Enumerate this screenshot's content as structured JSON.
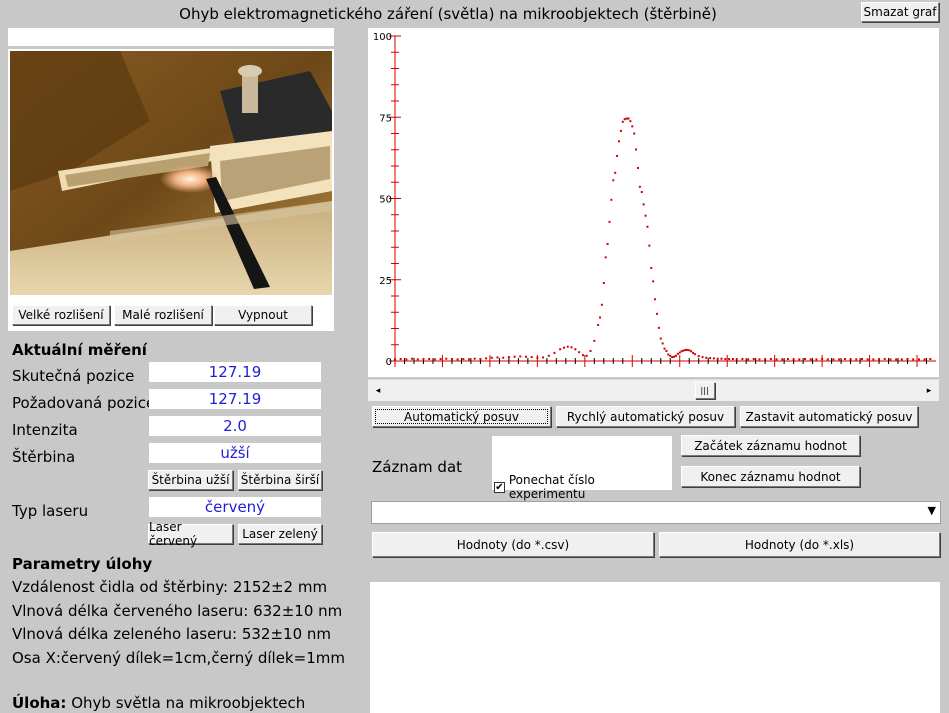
{
  "window": {
    "title": "Ohyb elektromagnetického záření (světla) na mikroobjektech (štěrbině)",
    "clear_graph_label": "Smazat graf"
  },
  "camera": {
    "buttons": [
      "Velké rozlišení",
      "Malé rozlišení",
      "Vypnout"
    ]
  },
  "measurement": {
    "heading": "Aktuální měření",
    "actual_position_label": "Skutečná pozice",
    "actual_position_value": "127.19",
    "requested_position_label": "Požadovaná pozice",
    "requested_position_value": "127.19",
    "intensity_label": "Intenzita",
    "intensity_value": "2.0",
    "slit_label": "Štěrbina",
    "slit_value": "užší",
    "slit_narrow_button": "Štěrbina užší",
    "slit_wide_button": "Štěrbina širší",
    "laser_label": "Typ laseru",
    "laser_value": "červený",
    "laser_red_button": "Laser červený",
    "laser_green_button": "Laser zelený"
  },
  "parameters": {
    "heading": "Parametry úlohy",
    "lines": [
      "Vzdálenost čidla od štěrbiny: 2152±2 mm",
      "Vlnová délka červeného laseru: 632±10 nm",
      "Vlnová délka zeleného laseru: 532±10 nm",
      "Osa X:červený dílek=1cm,černý dílek=1mm"
    ],
    "task_label": "Úloha:",
    "task_value": "Ohyb světla na mikroobjektech"
  },
  "controls": {
    "auto_move": "Automatický posuv",
    "fast_auto_move": "Rychlý automatický posuv",
    "stop_auto_move": "Zastavit automatický posuv",
    "record_label": "Záznam dat",
    "keep_number_label": "Ponechat číslo experimentu",
    "keep_number_checked": true,
    "start_record": "Začátek záznamu hodnot",
    "end_record": "Konec záznamu hodnot",
    "dropdown_value": "",
    "export_csv": "Hodnoty (do *.csv)",
    "export_xls": "Hodnoty (do *.xls)"
  },
  "scrollbar": {
    "left_arrow": "◂",
    "right_arrow": "▸",
    "thumb_grip": "|||",
    "thumb_fraction": 0.6
  },
  "chart_data": {
    "type": "scatter",
    "color": "#d00000",
    "yticks": [
      "100",
      "75",
      "50",
      "25",
      "0"
    ],
    "ylim": [
      0,
      100
    ],
    "xlim": [
      0,
      570
    ],
    "x": [
      0,
      6,
      12,
      18,
      24,
      30,
      36,
      42,
      48,
      54,
      60,
      66,
      72,
      78,
      84,
      90,
      96,
      102,
      108,
      114,
      120,
      126,
      132,
      138,
      144,
      150,
      156,
      162,
      168,
      174,
      178,
      182,
      186,
      190,
      194,
      198,
      202,
      206,
      210,
      214,
      216,
      218,
      220,
      222,
      224,
      226,
      228,
      230,
      232,
      234,
      236,
      238,
      240,
      242,
      244,
      246,
      248,
      250,
      252,
      254,
      256,
      258,
      260,
      262,
      264,
      266,
      268,
      270,
      272,
      274,
      276,
      278,
      280,
      282,
      284,
      286,
      288,
      290,
      292,
      294,
      296,
      298,
      300,
      302,
      304,
      306,
      308,
      310,
      312,
      314,
      316,
      320,
      324,
      328,
      332,
      336,
      340,
      344,
      348,
      352,
      356,
      360,
      366,
      372,
      378,
      384,
      390,
      396,
      402,
      408,
      414,
      420,
      426,
      432,
      438,
      444,
      450,
      456,
      462,
      468,
      474,
      480,
      486,
      492,
      498,
      504,
      510,
      516,
      522,
      528,
      534,
      540,
      546,
      552,
      558,
      564
    ],
    "y": [
      0.5,
      0.6,
      0.5,
      0.7,
      0.5,
      0.6,
      0.6,
      0.5,
      0.6,
      0.7,
      0.6,
      0.5,
      0.6,
      0.5,
      0.7,
      0.6,
      0.8,
      1.0,
      1.1,
      1.0,
      1.2,
      1.3,
      1.4,
      1.3,
      1.2,
      1.0,
      1.1,
      1.6,
      2.5,
      3.6,
      4.1,
      4.4,
      4.2,
      3.6,
      2.7,
      1.8,
      1.6,
      3.1,
      6.2,
      11.1,
      13.4,
      17.3,
      24.0,
      31.9,
      36.0,
      42.8,
      49.6,
      55.6,
      57.9,
      63.1,
      67.6,
      70.8,
      73.6,
      74.4,
      74.6,
      74.6,
      73.8,
      72.2,
      70.0,
      65.1,
      59.4,
      53.6,
      52.0,
      48.2,
      44.7,
      41.3,
      35.5,
      28.6,
      24.5,
      19.0,
      14.5,
      10.2,
      6.9,
      5.4,
      3.8,
      3.1,
      2.0,
      1.6,
      1.2,
      1.3,
      1.6,
      2.2,
      2.6,
      3.0,
      3.2,
      3.4,
      3.4,
      3.3,
      3.0,
      2.5,
      2.1,
      1.5,
      1.2,
      1.0,
      0.9,
      0.8,
      0.7,
      0.7,
      0.6,
      0.6,
      0.6,
      0.5,
      0.6,
      0.5,
      0.6,
      0.5,
      0.5,
      0.6,
      0.5,
      0.5,
      0.6,
      0.5,
      0.5,
      0.6,
      0.5,
      0.5,
      0.6,
      0.5,
      0.5,
      0.5,
      0.6,
      0.5,
      0.5,
      0.6,
      0.5,
      0.5,
      0.5,
      0.6,
      0.5,
      0.5,
      0.5,
      0.6,
      0.5,
      0.5,
      0.5,
      0.6
    ],
    "grid": false
  }
}
